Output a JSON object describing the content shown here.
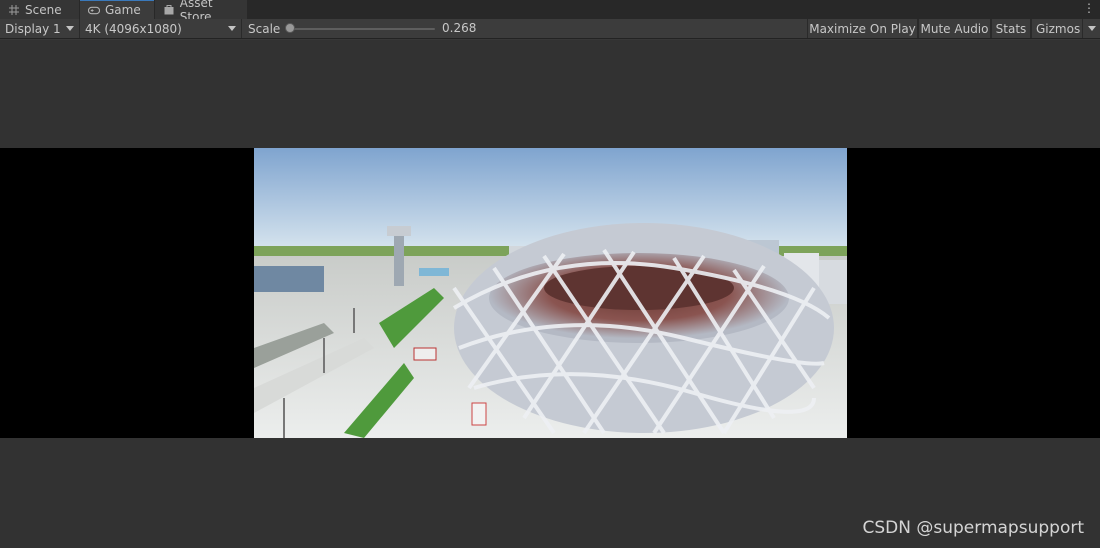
{
  "tabs": [
    {
      "label": "Scene",
      "icon": "grid-icon"
    },
    {
      "label": "Game",
      "icon": "gamepad-icon"
    },
    {
      "label": "Asset Store",
      "icon": "store-bag-icon"
    }
  ],
  "toolbar": {
    "display_label": "Display 1",
    "resolution_label": "4K (4096x1080)",
    "scale_label": "Scale",
    "scale_value": "0.268",
    "maximize_label": "Maximize On Play",
    "mute_label": "Mute Audio",
    "stats_label": "Stats",
    "gizmos_label": "Gizmos"
  },
  "game_view": {
    "scene": "3D stadium (Bird's Nest) rendered city scene"
  },
  "watermark": "CSDN @supermapsupport",
  "colors": {
    "accent": "#3a79bb",
    "panel_bg": "#383838",
    "toolbar_bg": "#3c3c3c",
    "letterbox": "#000000"
  }
}
